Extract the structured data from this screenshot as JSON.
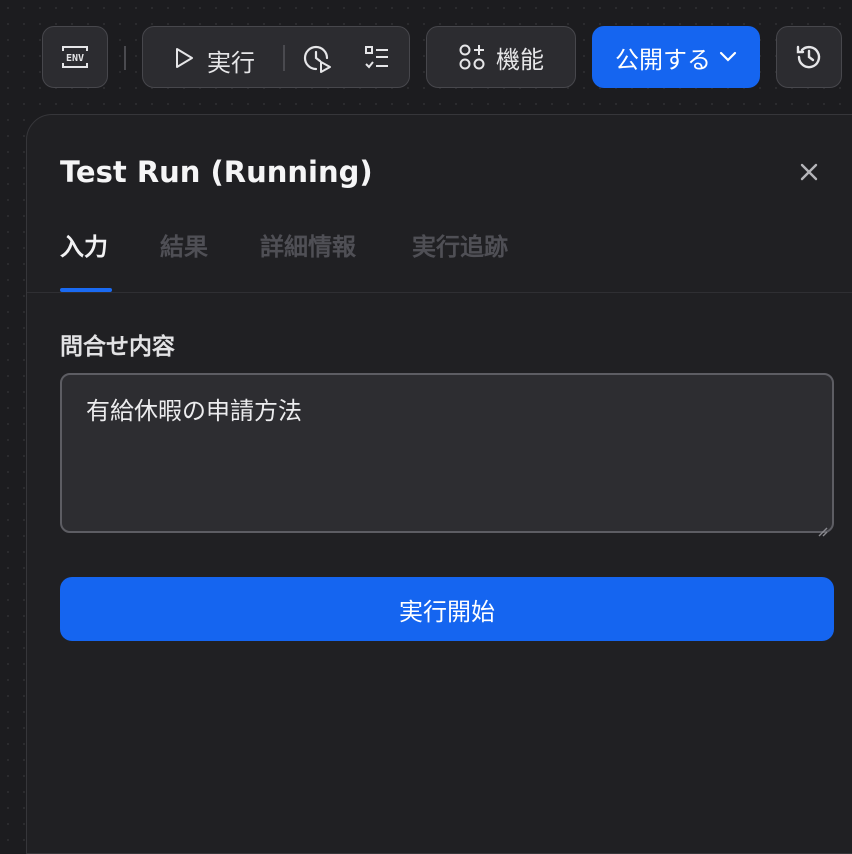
{
  "toolbar": {
    "env_icon": "env-icon",
    "run_label": "実行",
    "features_label": "機能",
    "publish_label": "公開する",
    "history_icon": "history-icon"
  },
  "panel": {
    "title": "Test Run (Running)",
    "tabs": [
      {
        "label": "入力",
        "active": true
      },
      {
        "label": "結果",
        "active": false
      },
      {
        "label": "詳細情報",
        "active": false
      },
      {
        "label": "実行追跡",
        "active": false
      }
    ],
    "field_label": "問合せ内容",
    "query_value": "有給休暇の申請方法",
    "run_button_label": "実行開始"
  },
  "colors": {
    "accent": "#1565f0",
    "background": "#1c1c1f",
    "panel": "#202023"
  }
}
